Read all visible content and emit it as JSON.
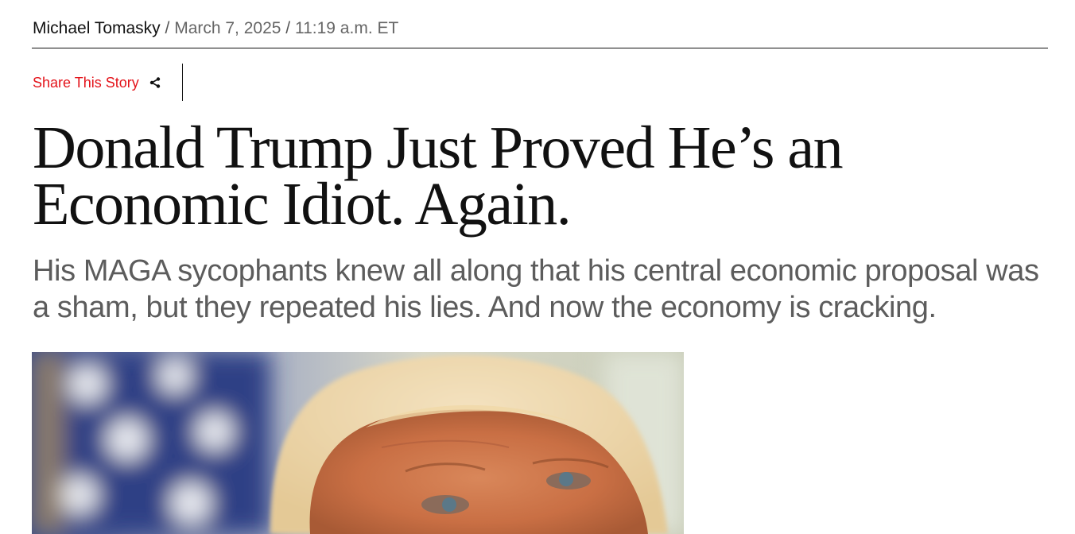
{
  "byline": {
    "author": "Michael Tomasky",
    "separator": "/",
    "date": "March 7, 2025",
    "time": "11:19 a.m. ET"
  },
  "share": {
    "label": "Share This Story",
    "icon": "share-icon",
    "color": "#e4131a"
  },
  "article": {
    "headline": "Donald Trump Just Proved He’s an Economic Idiot. Again.",
    "dek": "His MAGA sycophants knew all along that his central economic proposal was a sham, but they repeated his lies. And now the economy is cracking."
  }
}
